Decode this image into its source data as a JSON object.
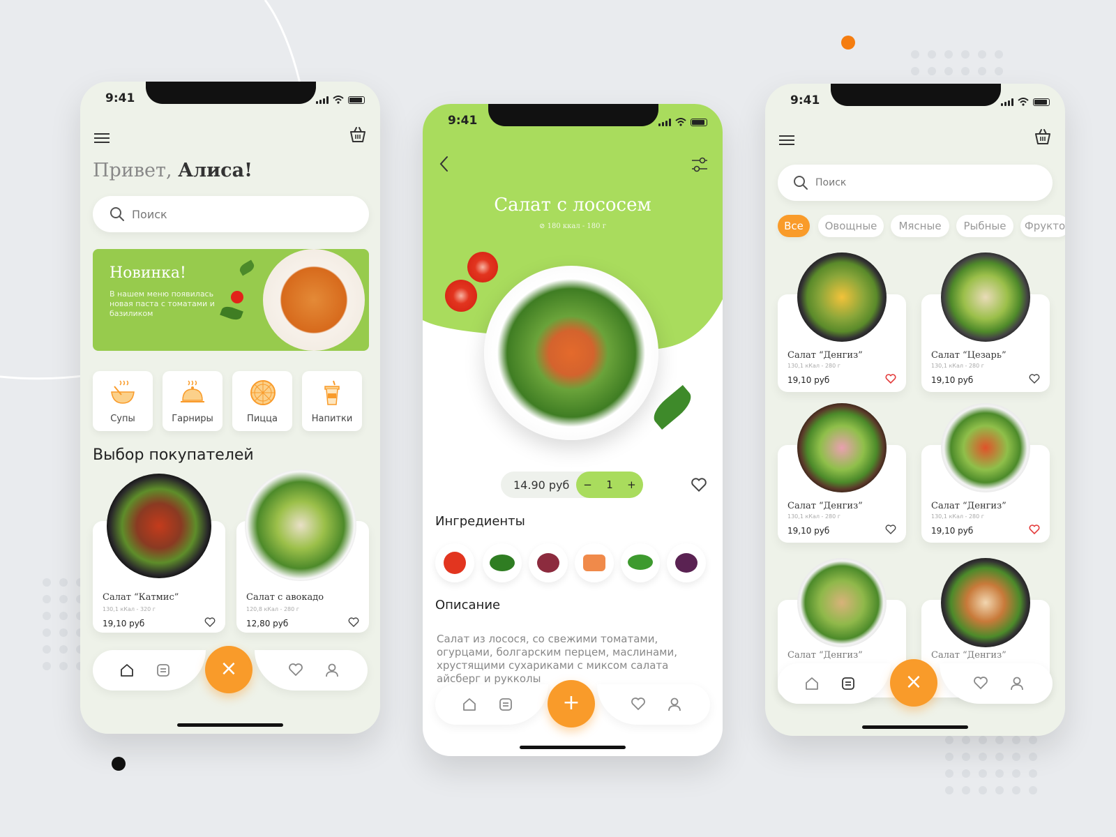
{
  "colors": {
    "accent": "#f99b2a",
    "green": "#a9dc5d",
    "bg": "#eef2e9"
  },
  "status": {
    "time": "9:41"
  },
  "screen1": {
    "greeting_prefix": "Привет,",
    "greeting_name": "Алиса!",
    "search_placeholder": "Поиск",
    "promo": {
      "title": "Новинка!",
      "text": "В нашем меню появилась новая паста с томатами и базиликом"
    },
    "categories": [
      {
        "label": "Супы",
        "icon": "soup-icon"
      },
      {
        "label": "Гарниры",
        "icon": "cloche-icon"
      },
      {
        "label": "Пицца",
        "icon": "pizza-icon"
      },
      {
        "label": "Напитки",
        "icon": "drink-icon"
      }
    ],
    "section_title": "Выбор покупателей",
    "products": [
      {
        "name": "Салат “Катмис”",
        "meta": "130,1 кКал - 320 г",
        "price": "19,10 руб"
      },
      {
        "name": "Салат с авокадо",
        "meta": "120,8 кКал - 280 г",
        "price": "12,80 руб"
      }
    ]
  },
  "screen2": {
    "title": "Салат с лососем",
    "subtitle": "180 ккал - 180 г",
    "price": "14.90 руб",
    "qty_minus": "−",
    "qty": "1",
    "qty_plus": "+",
    "ingredients_title": "Ингредиенты",
    "ingredients": [
      "tomato",
      "spinach",
      "onion",
      "salmon",
      "parsley",
      "red-cabbage"
    ],
    "description_title": "Описание",
    "description": "Салат  из лосося, со свежими томатами, огурцами, болгарским перцем, маслинами, хрустящими сухариками с миксом салата айсберг и рукколы"
  },
  "screen3": {
    "search_placeholder": "Поиск",
    "chips": [
      "Все",
      "Овощные",
      "Мясные",
      "Рыбные",
      "Фрукто"
    ],
    "products": [
      {
        "name": "Салат “Денгиз”",
        "meta": "130,1 кКал - 280 г",
        "price": "19,10 руб",
        "favorite": true
      },
      {
        "name": "Салат “Цезарь”",
        "meta": "130,1 кКал - 280 г",
        "price": "19,10 руб",
        "favorite": false
      },
      {
        "name": "Салат “Денгиз”",
        "meta": "130,1 кКал - 280 г",
        "price": "19,10 руб",
        "favorite": false
      },
      {
        "name": "Салат “Денгиз”",
        "meta": "130,1 кКал - 280 г",
        "price": "19,10 руб",
        "favorite": true
      },
      {
        "name": "Салат “Денгиз”",
        "meta": "",
        "price": "",
        "favorite": false
      },
      {
        "name": "Салат “Денгиз”",
        "meta": "",
        "price": "",
        "favorite": false
      }
    ]
  },
  "fab": {
    "close": "×",
    "add": "+"
  }
}
